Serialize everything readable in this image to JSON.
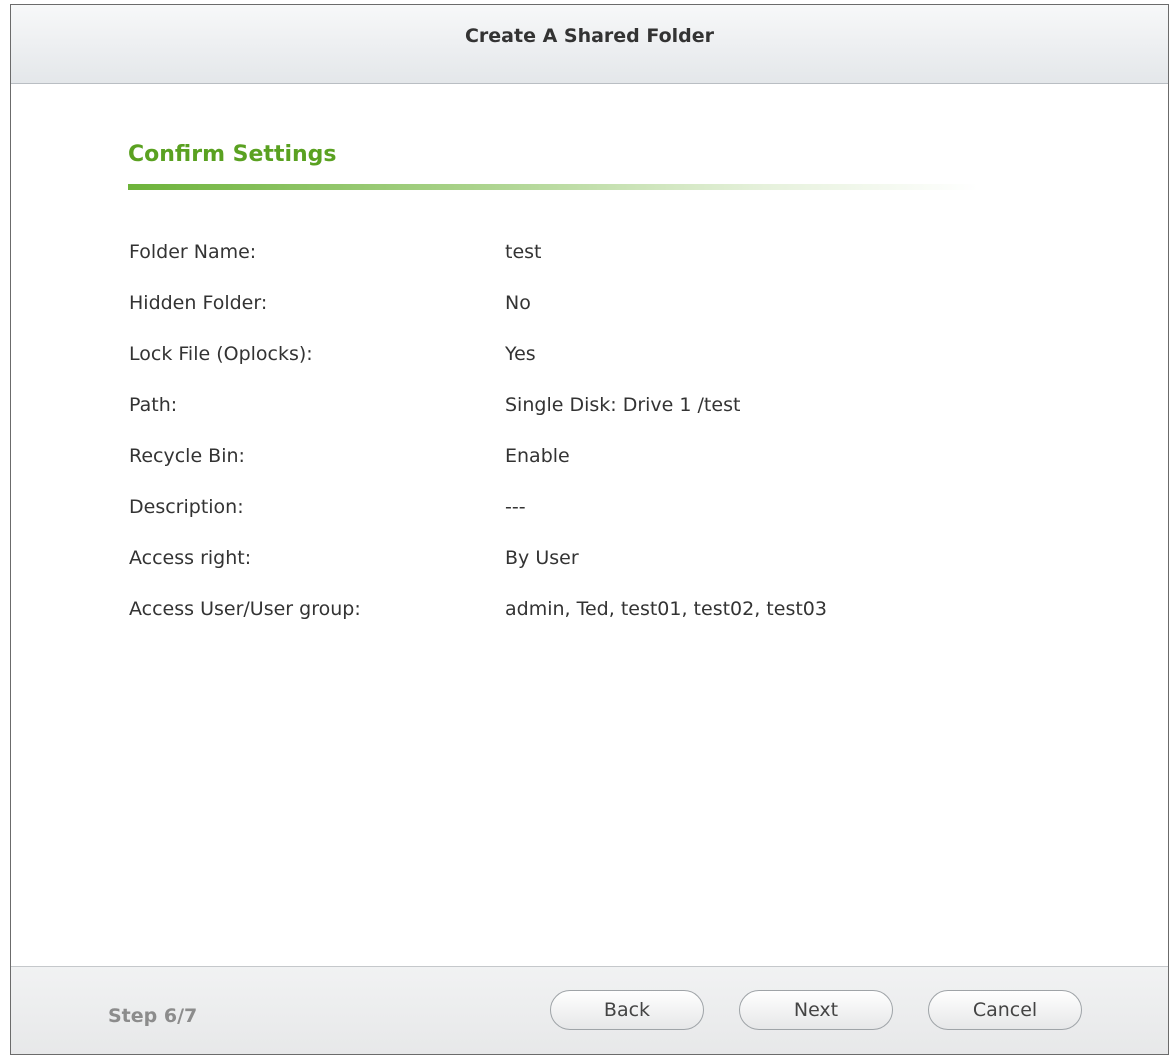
{
  "dialog": {
    "title": "Create A Shared Folder"
  },
  "section": {
    "title": "Confirm Settings"
  },
  "settings": [
    {
      "label": "Folder Name:",
      "value": "test"
    },
    {
      "label": "Hidden Folder:",
      "value": "No"
    },
    {
      "label": "Lock File (Oplocks):",
      "value": "Yes"
    },
    {
      "label": "Path:",
      "value": "Single Disk: Drive 1 /test"
    },
    {
      "label": "Recycle Bin:",
      "value": "Enable"
    },
    {
      "label": "Description:",
      "value": "---"
    },
    {
      "label": "Access right:",
      "value": "By User"
    },
    {
      "label": "Access User/User group:",
      "value": "admin, Ted, test01, test02, test03"
    }
  ],
  "footer": {
    "step": "Step 6/7",
    "back_label": "Back",
    "next_label": "Next",
    "cancel_label": "Cancel"
  }
}
